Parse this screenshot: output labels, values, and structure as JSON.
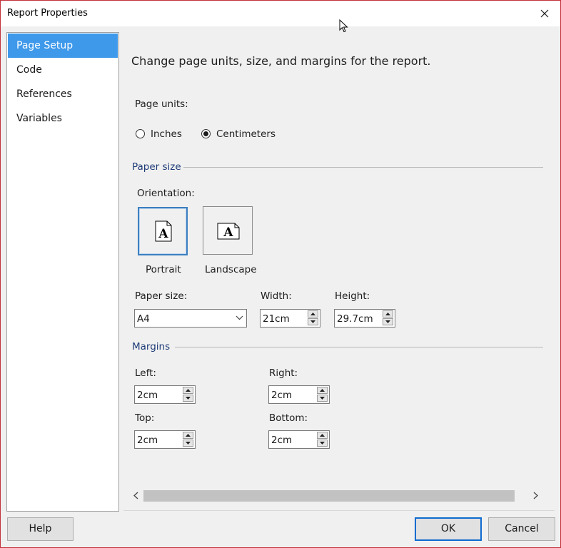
{
  "window": {
    "title": "Report Properties"
  },
  "sidebar": {
    "items": [
      {
        "label": "Page Setup",
        "selected": true
      },
      {
        "label": "Code",
        "selected": false
      },
      {
        "label": "References",
        "selected": false
      },
      {
        "label": "Variables",
        "selected": false
      }
    ]
  },
  "main": {
    "heading": "Change page units, size, and margins for the report.",
    "page_units": {
      "label": "Page units:",
      "options": [
        "Inches",
        "Centimeters"
      ],
      "selected": "Centimeters"
    },
    "paper_size_section": {
      "title": "Paper size",
      "orientation_label": "Orientation:",
      "orientations": [
        "Portrait",
        "Landscape"
      ],
      "selected_orientation": "Portrait",
      "orientation_glyph": "A",
      "paper_size_label": "Paper size:",
      "paper_size_value": "A4",
      "width_label": "Width:",
      "width_value": "21cm",
      "height_label": "Height:",
      "height_value": "29.7cm"
    },
    "margins_section": {
      "title": "Margins",
      "left_label": "Left:",
      "left_value": "2cm",
      "right_label": "Right:",
      "right_value": "2cm",
      "top_label": "Top:",
      "top_value": "2cm",
      "bottom_label": "Bottom:",
      "bottom_value": "2cm"
    }
  },
  "footer": {
    "help_label": "Help",
    "ok_label": "OK",
    "cancel_label": "Cancel"
  },
  "colors": {
    "selection": "#3e99ea",
    "section_title": "#1f3c78",
    "default_button_border": "#0f6bd0",
    "window_border": "#c4303a"
  }
}
